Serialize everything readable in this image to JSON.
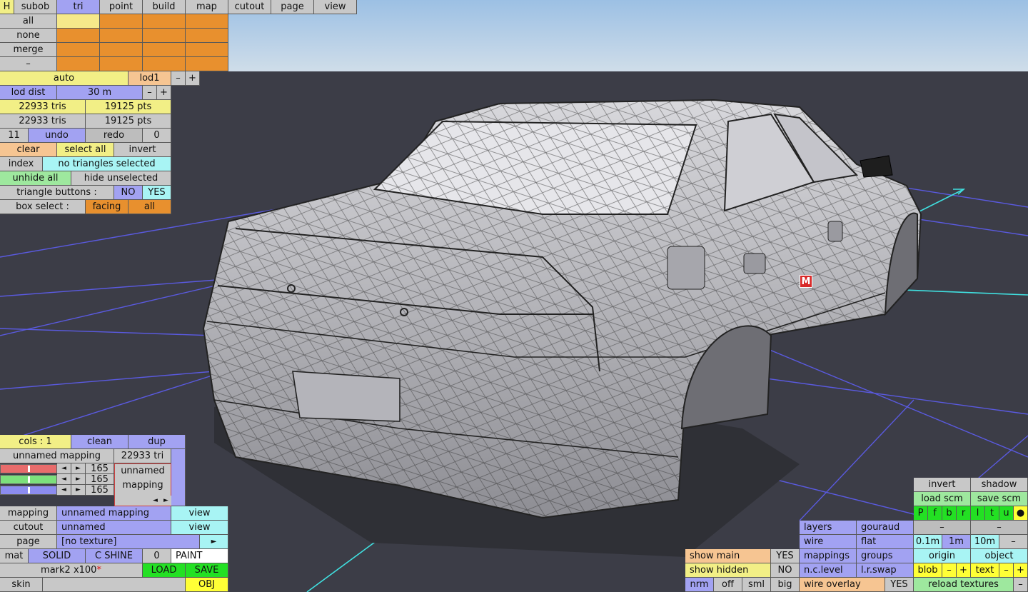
{
  "menu": {
    "h": "H",
    "subob": "subob",
    "tri": "tri",
    "point": "point",
    "build": "build",
    "map": "map",
    "cutout": "cutout",
    "page": "page",
    "view": "view"
  },
  "sel": {
    "all": "all",
    "none": "none",
    "merge": "merge",
    "dash": "–"
  },
  "lod": {
    "auto": "auto",
    "lod1": "lod1",
    "minus": "–",
    "plus": "+",
    "dist_label": "lod dist",
    "dist_value": "30 m"
  },
  "stats": {
    "tris1": "22933 tris",
    "pts1": "19125 pts",
    "tris2": "22933 tris",
    "pts2": "19125 pts"
  },
  "undo": {
    "count": "11",
    "undo": "undo",
    "redo": "redo",
    "redo_count": "0"
  },
  "selection": {
    "clear": "clear",
    "select_all": "select all",
    "invert": "invert",
    "index": "index",
    "status": "no triangles selected",
    "unhide_all": "unhide all",
    "hide_unselected": "hide unselected",
    "tri_buttons": "triangle buttons :",
    "no": "NO",
    "yes": "YES",
    "box_select": "box select :",
    "facing": "facing",
    "box_all": "all"
  },
  "mapping_panel": {
    "cols": "cols : 1",
    "clean": "clean",
    "dup": "dup",
    "mapping_name": "unnamed mapping",
    "tri_count": "22933 tri",
    "channels": [
      {
        "value": "165",
        "color": "#e86c6c",
        "level": 0.5
      },
      {
        "value": "165",
        "color": "#7ce07c",
        "level": 0.5
      },
      {
        "value": "165",
        "color": "#8c8cf0",
        "level": 0.5
      }
    ],
    "left_arrow": "◄",
    "right_arrow": "►",
    "preview": "unnamed mapping",
    "mapping_label": "mapping",
    "mapping_value": "unnamed mapping",
    "view1": "view",
    "cutout_label": "cutout",
    "cutout_value": "unnamed",
    "view2": "view",
    "page_label": "page",
    "page_value": "[no texture]",
    "page_arrow": "►",
    "mat": "mat",
    "solid": "SOLID",
    "c_shine": "C SHINE",
    "zero": "0",
    "paint": "PAINT",
    "material_name": "mark2 x100",
    "material_star": "*",
    "load": "LOAD",
    "save": "SAVE",
    "skin": "skin",
    "obj": "OBJ"
  },
  "viewport": {
    "marker": "M"
  },
  "bottom_right": {
    "show_main": "show main",
    "show_main_val": "YES",
    "show_hidden": "show hidden",
    "show_hidden_val": "NO",
    "nrm": "nrm",
    "off": "off",
    "sml": "sml",
    "big": "big",
    "layers": "layers",
    "gouraud": "gouraud",
    "wire": "wire",
    "flat": "flat",
    "mappings": "mappings",
    "groups": "groups",
    "nc_level": "n.c.level",
    "lr_swap": "l.r.swap",
    "wire_overlay": "wire overlay",
    "wire_overlay_val": "YES",
    "invert": "invert",
    "shadow": "shadow",
    "load_scm": "load scm",
    "save_scm": "save scm",
    "toggles": [
      "P",
      "f",
      "b",
      "r",
      "l",
      "t",
      "u",
      "●"
    ],
    "dash1": "–",
    "dash2": "–",
    "scale_01": "0.1m",
    "scale_1": "1m",
    "scale_10": "10m",
    "scale_minus": "–",
    "origin": "origin",
    "object": "object",
    "blob": "blob",
    "blob_minus": "–",
    "blob_plus": "+",
    "text": "text",
    "text_minus": "–",
    "text_plus": "+",
    "reload": "reload textures",
    "reload_minus": "–"
  }
}
